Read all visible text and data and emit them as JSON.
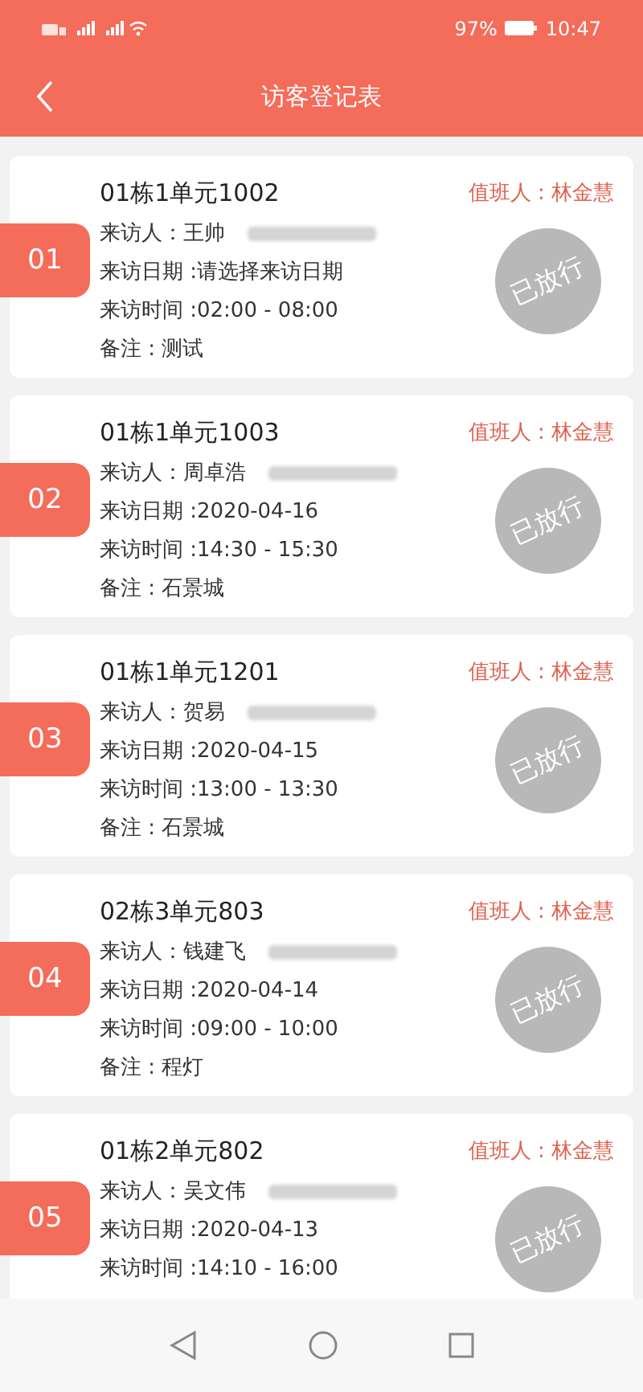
{
  "status_bar": {
    "battery": "97%",
    "time": "10:47"
  },
  "header": {
    "title": "访客登记表"
  },
  "records": [
    {
      "index": "01",
      "address": "01栋1单元1002",
      "duty": "值班人 : 林金慧",
      "visitor": "来访人：王帅",
      "date": "来访日期 :请选择来访日期",
      "time": "来访时间 :02:00 - 08:00",
      "remark": "备注 : 测试",
      "stamp": "已放行"
    },
    {
      "index": "02",
      "address": "01栋1单元1003",
      "duty": "值班人 : 林金慧",
      "visitor": "来访人：周卓浩",
      "date": "来访日期 :2020-04-16",
      "time": "来访时间 :14:30 - 15:30",
      "remark": "备注 : 石景城",
      "stamp": "已放行"
    },
    {
      "index": "03",
      "address": "01栋1单元1201",
      "duty": "值班人 : 林金慧",
      "visitor": "来访人：贺易",
      "date": "来访日期 :2020-04-15",
      "time": "来访时间 :13:00 - 13:30",
      "remark": "备注 : 石景城",
      "stamp": "已放行"
    },
    {
      "index": "04",
      "address": "02栋3单元803",
      "duty": "值班人 : 林金慧",
      "visitor": "来访人：钱建飞",
      "date": "来访日期 :2020-04-14",
      "time": "来访时间 :09:00 - 10:00",
      "remark": "备注 : 程灯",
      "stamp": "已放行"
    },
    {
      "index": "05",
      "address": "01栋2单元802",
      "duty": "值班人 : 林金慧",
      "visitor": "来访人：吴文伟",
      "date": "来访日期 :2020-04-13",
      "time": "来访时间 :14:10 - 16:00",
      "stamp": "已放行"
    }
  ]
}
